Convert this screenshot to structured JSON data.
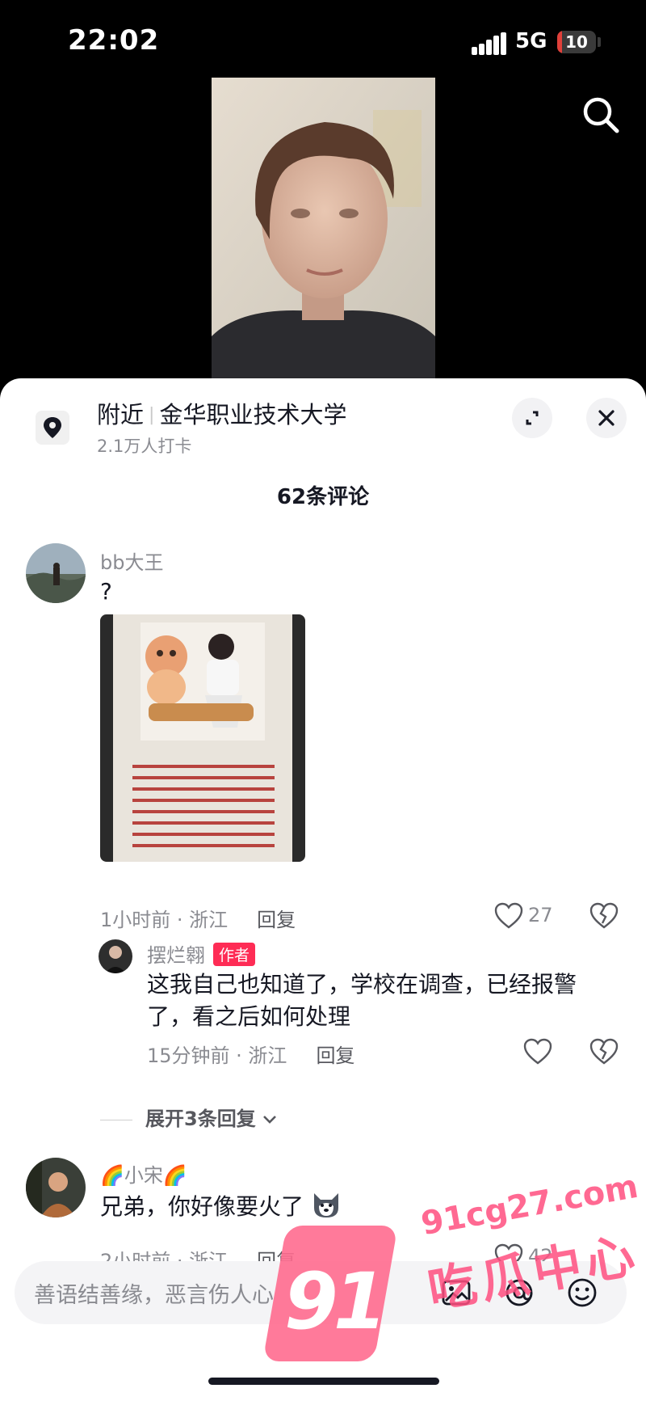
{
  "status": {
    "time": "22:02",
    "network": "5G",
    "battery": "10"
  },
  "location": {
    "prefix": "附近",
    "name": "金华职业技术大学",
    "checkins": "2.1万人打卡"
  },
  "comment_count": "62条评论",
  "comments": [
    {
      "username": "bb大王",
      "text": "?",
      "meta": "1小时前 · 浙江",
      "reply_label": "回复",
      "likes": "27"
    },
    {
      "username": "🌈小宋🌈",
      "text": "兄弟，你好像要火了",
      "meta": "2小时前 · 浙江",
      "reply_label": "回复",
      "likes": "42"
    }
  ],
  "reply": {
    "username": "摆烂翱",
    "badge": "作者",
    "text": "这我自己也知道了，学校在调查，已经报警了，看之后如何处理",
    "meta": "15分钟前 · 浙江",
    "reply_label": "回复"
  },
  "expand_replies": "展开3条回复",
  "input": {
    "placeholder": "善语结善缘，恶言伤人心"
  },
  "watermark": {
    "badge": "91",
    "url": "91cg27.com",
    "name": "吃瓜中心"
  },
  "colors": {
    "accent": "#fe2c55",
    "watermark": "#ff4f80"
  },
  "icons": [
    "search-icon",
    "location-pin-icon",
    "expand-icon",
    "close-icon",
    "heart-icon",
    "broken-heart-icon",
    "image-icon",
    "at-icon",
    "emoji-icon",
    "chevron-down-icon"
  ]
}
